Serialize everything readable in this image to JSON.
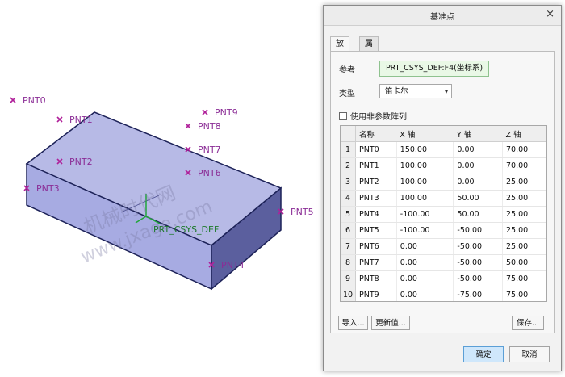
{
  "viewport": {
    "points": [
      "PNT0",
      "PNT1",
      "PNT2",
      "PNT3",
      "PNT4",
      "PNT5",
      "PNT6",
      "PNT7",
      "PNT8",
      "PNT9"
    ],
    "csys_label": "PRT_CSYS_DEF",
    "watermark_line1": "机械时代网",
    "watermark_line2": "www.jxage.com"
  },
  "dialog": {
    "title": "基准点",
    "close_glyph": "×",
    "tabs": [
      "放置",
      "属性"
    ],
    "reference_label": "参考",
    "reference_value": "PRT_CSYS_DEF:F4(坐标系)",
    "type_label": "类型",
    "type_value": "笛卡尔",
    "type_arrow": "▾",
    "nonparam_label": "使用非参数阵列",
    "table": {
      "headers": [
        "名称",
        "X 轴",
        "Y 轴",
        "Z 轴"
      ],
      "rows": [
        [
          "1",
          "PNT0",
          "150.00",
          "0.00",
          "70.00"
        ],
        [
          "2",
          "PNT1",
          "100.00",
          "0.00",
          "70.00"
        ],
        [
          "3",
          "PNT2",
          "100.00",
          "0.00",
          "25.00"
        ],
        [
          "4",
          "PNT3",
          "100.00",
          "50.00",
          "25.00"
        ],
        [
          "5",
          "PNT4",
          "-100.00",
          "50.00",
          "25.00"
        ],
        [
          "6",
          "PNT5",
          "-100.00",
          "-50.00",
          "25.00"
        ],
        [
          "7",
          "PNT6",
          "0.00",
          "-50.00",
          "25.00"
        ],
        [
          "8",
          "PNT7",
          "0.00",
          "-50.00",
          "50.00"
        ],
        [
          "9",
          "PNT8",
          "0.00",
          "-50.00",
          "75.00"
        ],
        [
          "10",
          "PNT9",
          "0.00",
          "-75.00",
          "75.00"
        ]
      ]
    },
    "buttons": {
      "import": "导入...",
      "update": "更新值...",
      "save": "保存...",
      "ok": "确定",
      "cancel": "取消"
    }
  }
}
